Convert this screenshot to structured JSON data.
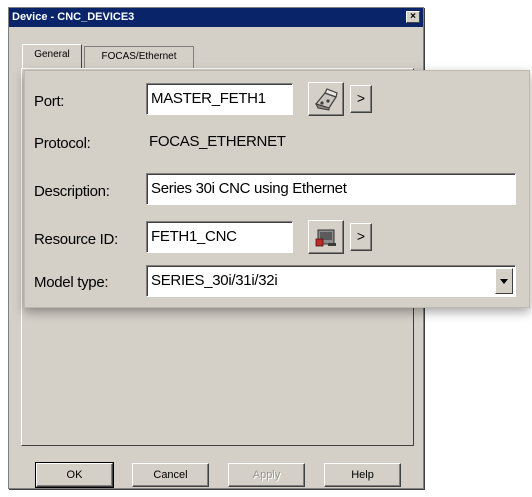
{
  "window": {
    "title": "Device - CNC_DEVICE3",
    "close_glyph": "×"
  },
  "tabs": [
    {
      "label": "General",
      "active": true
    },
    {
      "label": "FOCAS/Ethernet",
      "active": false
    }
  ],
  "form": {
    "port": {
      "label": "Port:",
      "value": "MASTER_FETH1",
      "more_glyph": ">"
    },
    "protocol": {
      "label": "Protocol:",
      "value": "FOCAS_ETHERNET"
    },
    "description": {
      "label": "Description:",
      "value": "Series 30i CNC using Ethernet"
    },
    "resource_id": {
      "label": "Resource ID:",
      "value": "FETH1_CNC",
      "more_glyph": ">"
    },
    "model_type": {
      "label": "Model type:",
      "value": "SERIES_30i/31i/32i"
    }
  },
  "buttons": {
    "ok": "OK",
    "cancel": "Cancel",
    "apply": "Apply",
    "help": "Help"
  },
  "icons": {
    "port_button": "port-config-icon",
    "resource_button": "resource-config-icon"
  }
}
